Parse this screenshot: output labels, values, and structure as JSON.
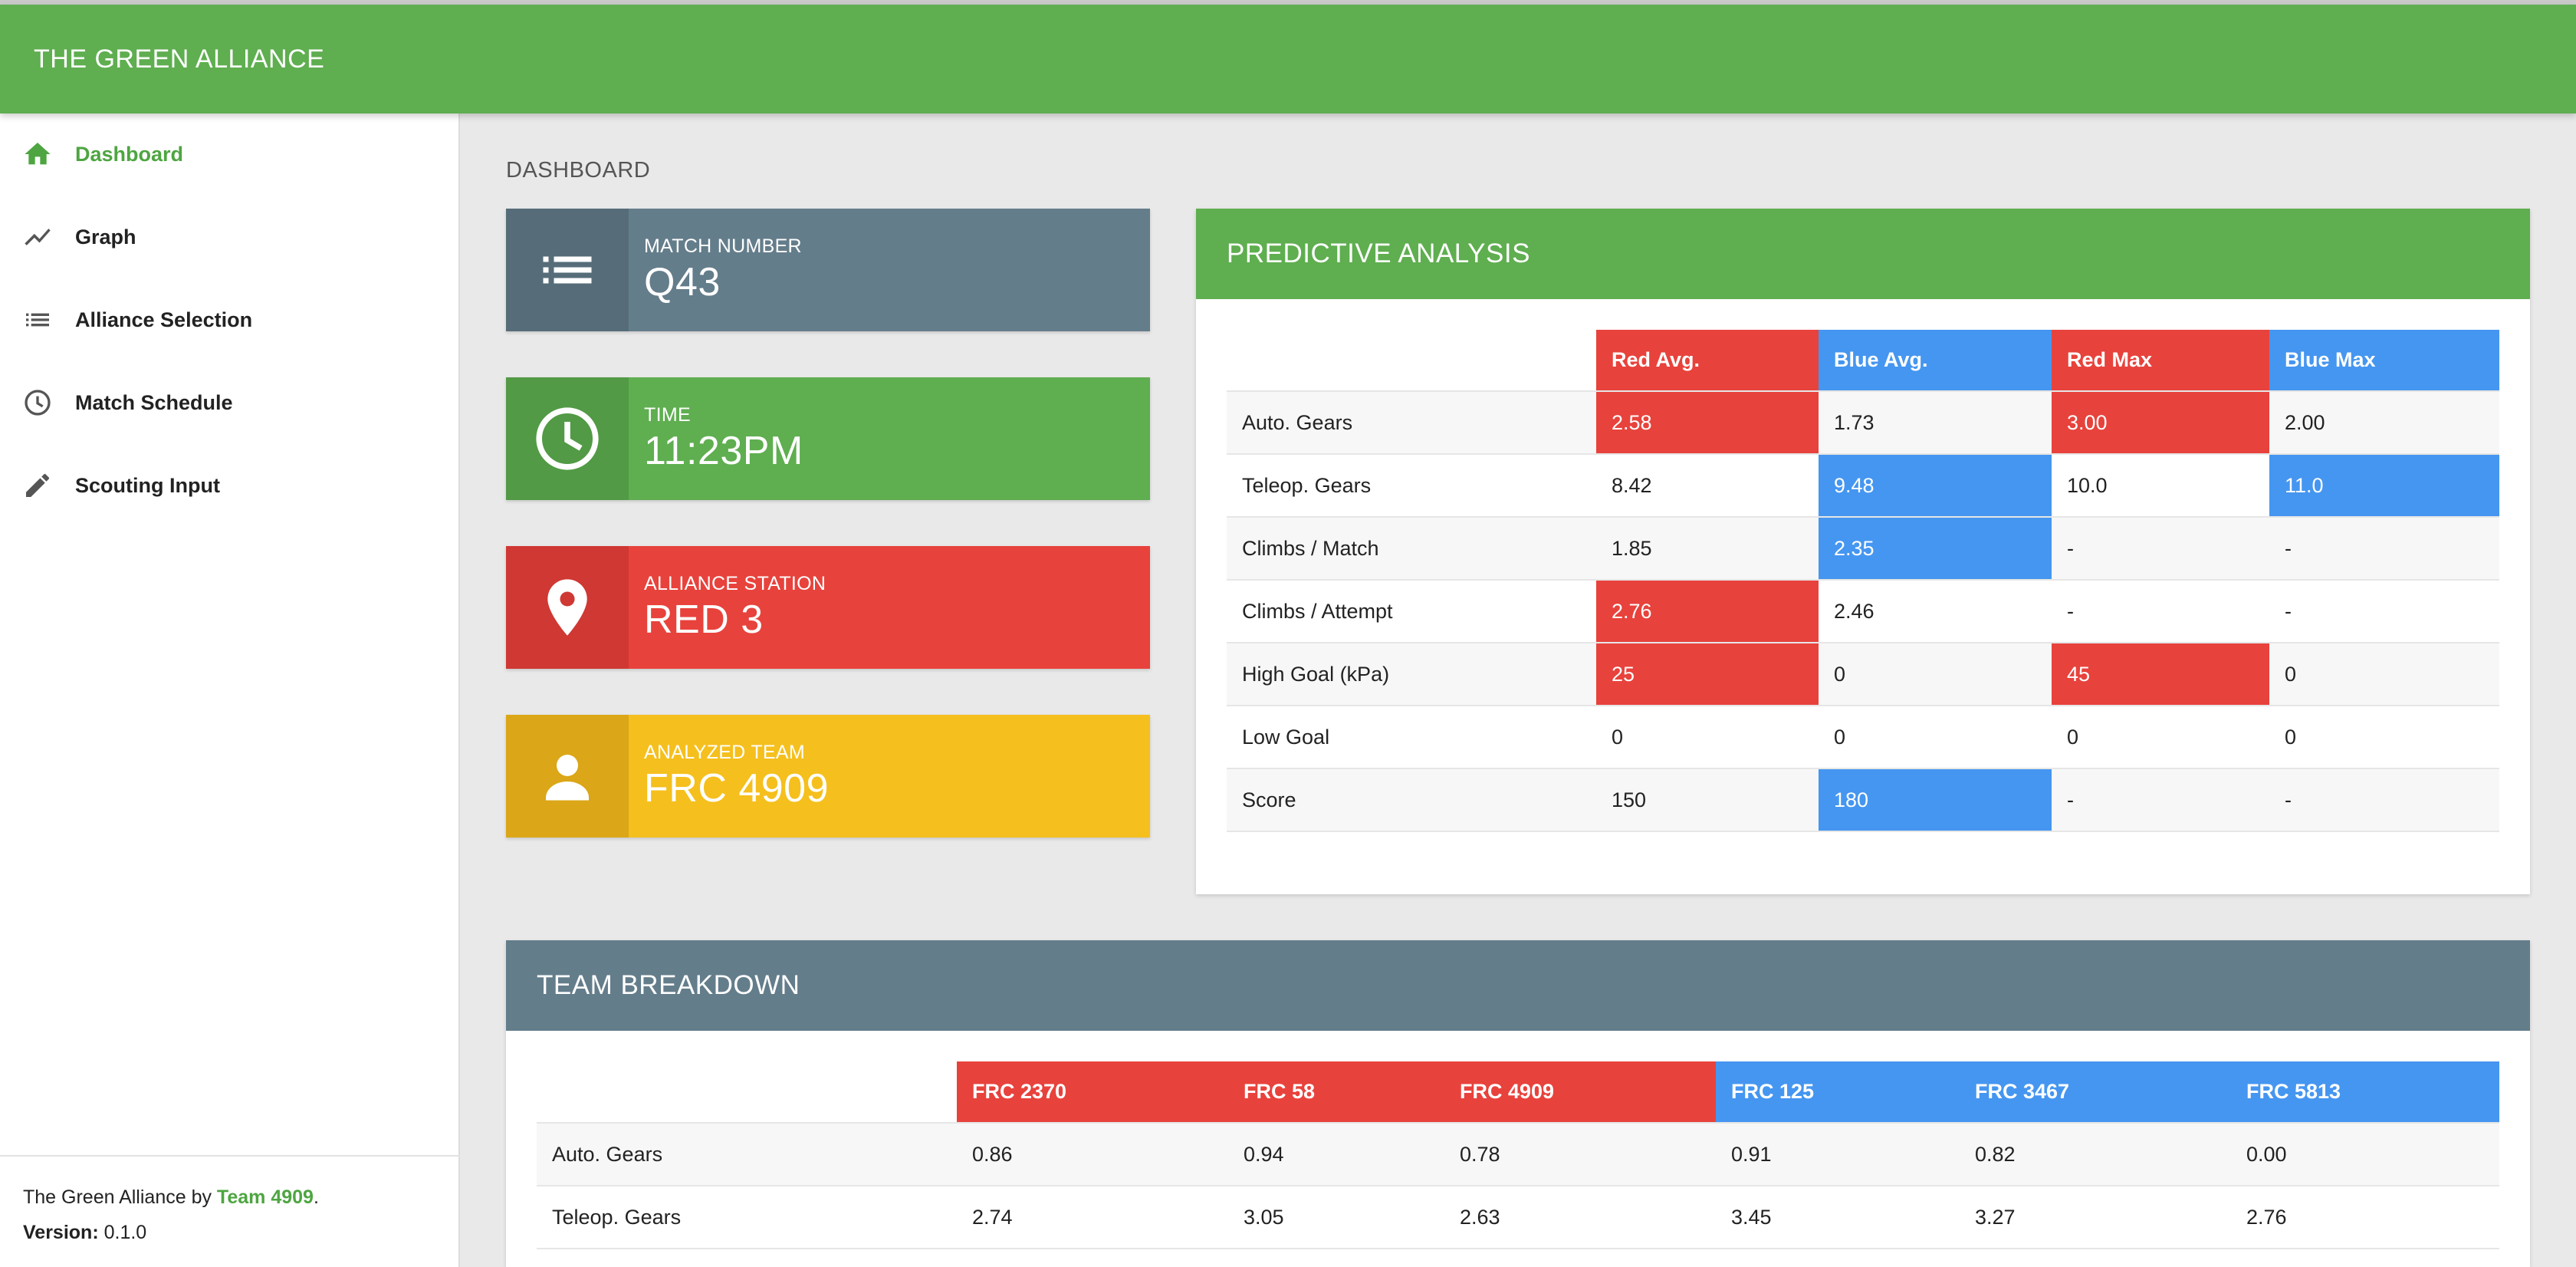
{
  "app": {
    "title": "THE GREEN ALLIANCE"
  },
  "colors": {
    "green": "#5fae50",
    "red": "#e8423c",
    "blue": "#4596f0",
    "slate": "#647d8b",
    "yellow": "#f5bf1d"
  },
  "sidebar": {
    "items": [
      {
        "label": "Dashboard",
        "icon": "home-icon",
        "active": true
      },
      {
        "label": "Graph",
        "icon": "trend-line-icon",
        "active": false
      },
      {
        "label": "Alliance Selection",
        "icon": "list-icon",
        "active": false
      },
      {
        "label": "Match Schedule",
        "icon": "clock-icon",
        "active": false
      },
      {
        "label": "Scouting Input",
        "icon": "pencil-icon",
        "active": false
      }
    ],
    "footer": {
      "text_prefix": "The Green Alliance by ",
      "team_link": "Team 4909",
      "text_suffix": ".",
      "version_label": "Version:",
      "version_value": " 0.1.0"
    }
  },
  "main": {
    "heading": "DASHBOARD",
    "cards": [
      {
        "label": "MATCH NUMBER",
        "value": "Q43",
        "icon": "list-icon"
      },
      {
        "label": "TIME",
        "value": "11:23PM",
        "icon": "clock-icon"
      },
      {
        "label": "ALLIANCE STATION",
        "value": "RED 3",
        "icon": "map-pin-icon"
      },
      {
        "label": "ANALYZED TEAM",
        "value": "FRC 4909",
        "icon": "person-icon"
      }
    ],
    "predictive": {
      "title": "PREDICTIVE ANALYSIS",
      "headers": [
        "Red Avg.",
        "Blue Avg.",
        "Red Max",
        "Blue Max"
      ],
      "rows": [
        {
          "label": "Auto. Gears",
          "cells": [
            "2.58",
            "1.73",
            "3.00",
            "2.00"
          ],
          "hl": [
            "red",
            "",
            "red",
            ""
          ]
        },
        {
          "label": "Teleop. Gears",
          "cells": [
            "8.42",
            "9.48",
            "10.0",
            "11.0"
          ],
          "hl": [
            "",
            "blue",
            "",
            "blue"
          ]
        },
        {
          "label": "Climbs / Match",
          "cells": [
            "1.85",
            "2.35",
            "-",
            "-"
          ],
          "hl": [
            "",
            "blue",
            "",
            ""
          ]
        },
        {
          "label": "Climbs / Attempt",
          "cells": [
            "2.76",
            "2.46",
            "-",
            "-"
          ],
          "hl": [
            "red",
            "",
            "",
            ""
          ]
        },
        {
          "label": "High Goal (kPa)",
          "cells": [
            "25",
            "0",
            "45",
            "0"
          ],
          "hl": [
            "red",
            "",
            "red",
            ""
          ]
        },
        {
          "label": "Low Goal",
          "cells": [
            "0",
            "0",
            "0",
            "0"
          ],
          "hl": [
            "",
            "",
            "",
            ""
          ]
        },
        {
          "label": "Score",
          "cells": [
            "150",
            "180",
            "-",
            "-"
          ],
          "hl": [
            "",
            "blue",
            "",
            ""
          ]
        }
      ]
    },
    "breakdown": {
      "title": "TEAM BREAKDOWN",
      "headers": [
        "FRC 2370",
        "FRC 58",
        "FRC 4909",
        "FRC 125",
        "FRC 3467",
        "FRC 5813"
      ],
      "rows": [
        {
          "label": "Auto. Gears",
          "cells": [
            "0.86",
            "0.94",
            "0.78",
            "0.91",
            "0.82",
            "0.00"
          ]
        },
        {
          "label": "Teleop. Gears",
          "cells": [
            "2.74",
            "3.05",
            "2.63",
            "3.45",
            "3.27",
            "2.76"
          ]
        }
      ]
    }
  }
}
